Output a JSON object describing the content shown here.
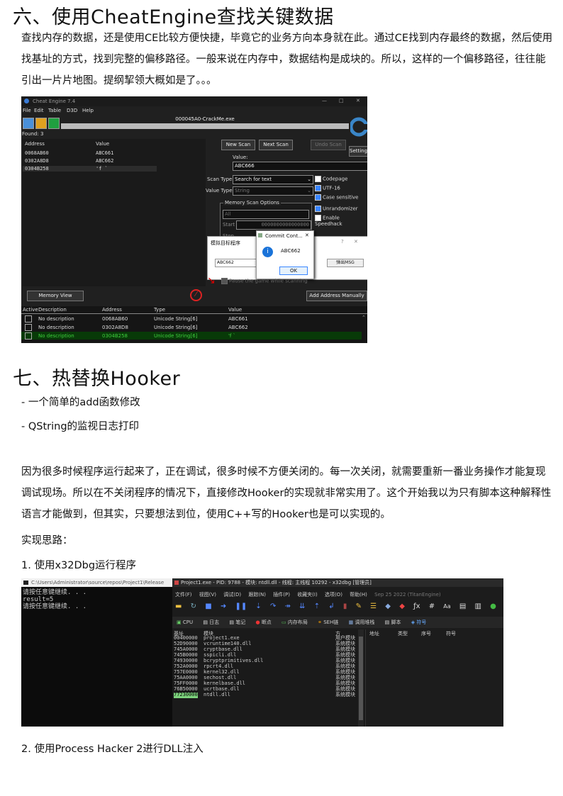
{
  "section6": {
    "heading": "六、使用CheatEngine查找关键数据",
    "para": "查找内存的数据，还是使用CE比较方便快捷，毕竟它的业务方向本身就在此。通过CE找到内存最终的数据，然后使用找基址的方式，找到完整的偏移路径。一般来说在内存中，数据结构是成块的。所以，这样的一个偏移路径，往往能引出一片片地图。提纲挈领大概如是了。。。"
  },
  "ce": {
    "title": "Cheat Engine 7.4",
    "menu": [
      "File",
      "Edit",
      "Table",
      "D3D",
      "Help"
    ],
    "process": "000045A0-CrackMe.exe",
    "found": "Found: 3",
    "col_address": "Address",
    "col_value": "Value",
    "results": [
      {
        "address": "0068AB60",
        "value": "ABC661"
      },
      {
        "address": "0302A8D8",
        "value": "ABC662"
      },
      {
        "address": "0304B258",
        "value": "'f  `"
      }
    ],
    "new_scan": "New Scan",
    "next_scan": "Next Scan",
    "undo_scan": "Undo Scan",
    "settings": "Settings",
    "value_label": "Value:",
    "value_input": "ABC666",
    "scan_type_label": "Scan Type",
    "scan_type_value": "Search for text",
    "value_type_label": "Value Type",
    "value_type_value": "String",
    "options": [
      {
        "label": "Codepage",
        "checked": false
      },
      {
        "label": "UTF-16",
        "checked": true
      },
      {
        "label": "Case sensitive",
        "checked": true
      },
      {
        "label": "Unrandomizer",
        "checked": true
      },
      {
        "label": "Enable Speedhack",
        "checked": false
      }
    ],
    "mem_scan_options": "Memory Scan Options",
    "all": "All",
    "start_label": "Start",
    "start_value": "0000000000000000",
    "stop_label": "Stop",
    "target_window_title": "模拟目标程序",
    "target_input": "ABC662",
    "target_button": "弹出MSG",
    "msg_title": "Commit Cont...",
    "msg_text": "ABC662",
    "msg_ok": "OK",
    "pause": "Pause the game while scanning",
    "memory_view": "Memory View",
    "add_manual": "Add Address Manually",
    "table_headers": [
      "Active",
      "Description",
      "Address",
      "Type",
      "Value"
    ],
    "table_rows": [
      {
        "desc": "No description",
        "address": "0068AB60",
        "type": "Unicode String[6]",
        "value": "ABC661"
      },
      {
        "desc": "No description",
        "address": "0302A8D8",
        "type": "Unicode String[6]",
        "value": "ABC662"
      },
      {
        "desc": "No description",
        "address": "0304B258",
        "type": "Unicode String[6]",
        "value": "'f  `"
      }
    ]
  },
  "section7": {
    "heading": "七、热替换Hooker",
    "bullets": [
      "- 一个简单的add函数修改",
      "- QString的监视日志打印"
    ],
    "para": "因为很多时候程序运行起来了，正在调试，很多时候不方便关闭的。每一次关闭，就需要重新一番业务操作才能复现调试现场。所以在不关闭程序的情况下，直接修改Hooker的实现就非常实用了。这个开始我以为只有脚本这种解释性语言才能做到，但其实，只要想法到位，使用C++写的Hooker也是可以实现的。",
    "ideas": "实现思路：",
    "step1": "1. 使用x32Dbg运行程序",
    "step2": "2. 使用Process Hacker 2进行DLL注入"
  },
  "xdbg": {
    "cmd_title": "C:\\Users\\Administrator\\source\\repos\\Project1\\Release",
    "cmd_lines": [
      "请按任意键继续. . .",
      "result=5",
      "请按任意键继续. . ."
    ],
    "title": "Project1.exe - PID: 9788 - 模块: ntdll.dll - 线程: 主线程 10292 - x32dbg [管理员]",
    "menu": [
      "文件(F)",
      "视图(V)",
      "调试(D)",
      "跟踪(N)",
      "插件(P)",
      "收藏夹(I)",
      "选项(O)",
      "帮助(H)",
      "Sep 25 2022 (TitanEngine)"
    ],
    "tabs": [
      "CPU",
      "日志",
      "笔记",
      "断点",
      "内存布局",
      "SEH链",
      "调用堆栈",
      "脚本",
      "符号"
    ],
    "col_base": "基址",
    "col_module": "模块",
    "col_party": "方",
    "col_addr": "地址",
    "col_type": "类型",
    "col_ord": "序号",
    "col_sym": "符号",
    "modules": [
      {
        "base": "00400000",
        "name": "project1.exe",
        "party": "用户模块"
      },
      {
        "base": "52D90000",
        "name": "vcruntime140.dll",
        "party": "系统模块"
      },
      {
        "base": "745A0000",
        "name": "cryptbase.dll",
        "party": "系统模块"
      },
      {
        "base": "745B0000",
        "name": "sspicli.dll",
        "party": "系统模块"
      },
      {
        "base": "74930000",
        "name": "bcryptprimitives.dll",
        "party": "系统模块"
      },
      {
        "base": "752A0000",
        "name": "rpcrt4.dll",
        "party": "系统模块"
      },
      {
        "base": "757E0000",
        "name": "kernel32.dll",
        "party": "系统模块"
      },
      {
        "base": "75AA0000",
        "name": "sechost.dll",
        "party": "系统模块"
      },
      {
        "base": "75FF0000",
        "name": "kernelbase.dll",
        "party": "系统模块"
      },
      {
        "base": "76B50000",
        "name": "ucrtbase.dll",
        "party": "系统模块"
      },
      {
        "base": "77230000",
        "name": "ntdll.dll",
        "party": "系统模块"
      }
    ]
  }
}
